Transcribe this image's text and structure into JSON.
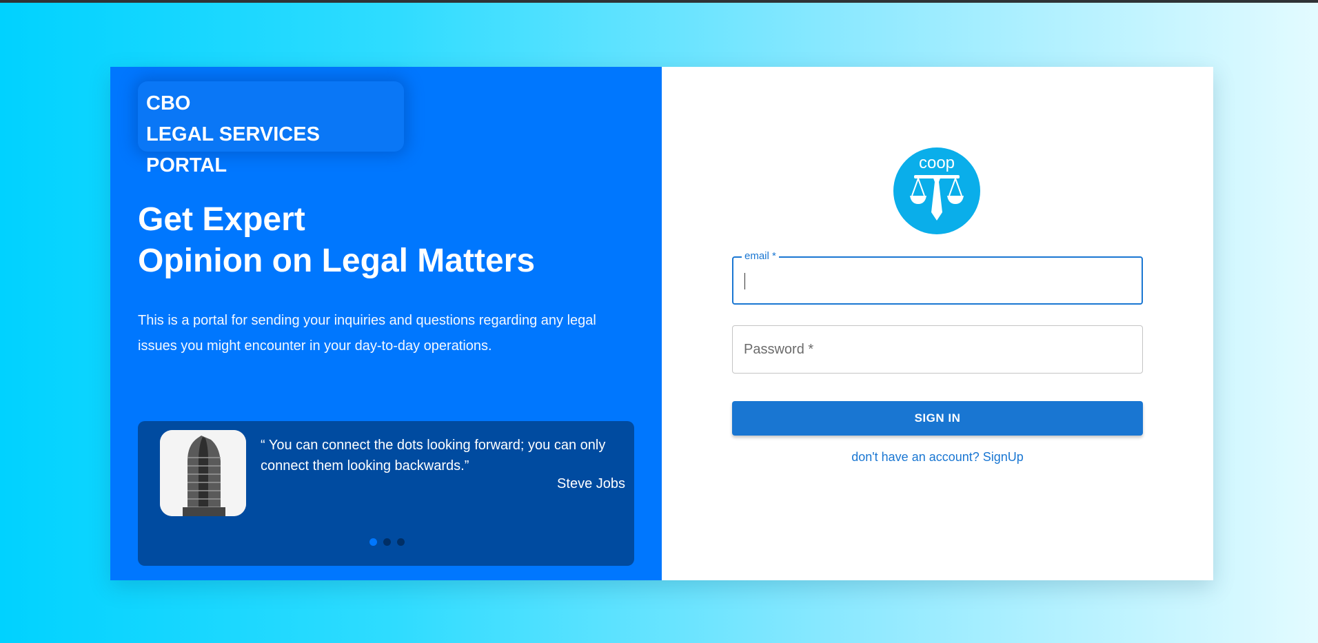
{
  "brand": {
    "line1": "CBO",
    "line2": "LEGAL SERVICES PORTAL"
  },
  "hero": {
    "line1": "Get Expert",
    "line2": "Opinion on Legal Matters",
    "description": "This is a portal for sending your inquiries and questions regarding any legal issues you might encounter in your day-to-day operations."
  },
  "testimonial": {
    "quote": "“ You can connect the dots looking forward; you can only connect them looking backwards.”",
    "author": "Steve Jobs",
    "active_slide": 1,
    "slide_count": 3
  },
  "logo": {
    "text": "coop",
    "icon": "scales-tie-icon",
    "color": "#0aaeea"
  },
  "form": {
    "email_label": "email *",
    "email_value": "",
    "password_placeholder": "Password *",
    "password_value": "",
    "signin_label": "SIGN IN",
    "signup_link": "don't have an account? SignUp"
  },
  "colors": {
    "left_panel": "#0077fe",
    "quote_box": "#004ba0",
    "primary": "#1976d2"
  }
}
